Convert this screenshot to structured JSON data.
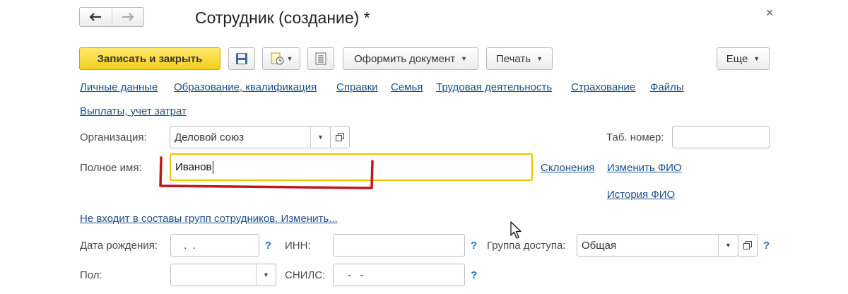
{
  "window": {
    "title": "Сотрудник (создание) *",
    "close_glyph": "×"
  },
  "nav": {
    "back_glyph": "🡐",
    "forward_glyph": "🡒"
  },
  "toolbar": {
    "save_close_label": "Записать и закрыть",
    "create_doc_label": "Оформить документ",
    "print_label": "Печать",
    "more_label": "Еще",
    "caret_glyph": "▼"
  },
  "tabs": [
    "Личные данные",
    "Образование, квалификация",
    "Справки",
    "Семья",
    "Трудовая деятельность",
    "Страхование",
    "Файлы",
    "Выплаты, учет затрат"
  ],
  "form": {
    "organization": {
      "label": "Организация:",
      "value": "Деловой союз"
    },
    "tab_number": {
      "label": "Таб. номер:",
      "value": ""
    },
    "full_name": {
      "label": "Полное имя:",
      "value": "Иванов"
    },
    "declensions_link": "Склонения",
    "change_name_link": "Изменить ФИО",
    "name_history_link": "История ФИО",
    "groups_link": "Не входит в составы групп сотрудников. Изменить...",
    "birth_date": {
      "label": "Дата рождения:",
      "value": " .  ."
    },
    "inn": {
      "label": "ИНН:",
      "value": ""
    },
    "access_group": {
      "label": "Группа доступа:",
      "value": "Общая"
    },
    "gender": {
      "label": "Пол:",
      "value": ""
    },
    "snils": {
      "label": "СНИЛС:",
      "value": "-   -"
    },
    "help_glyph": "?"
  },
  "colors": {
    "accent_yellow": "#f5cf1d",
    "focus_border": "#f2c200",
    "link_blue": "#1c4e8a",
    "annotation_red": "#c4161c"
  }
}
